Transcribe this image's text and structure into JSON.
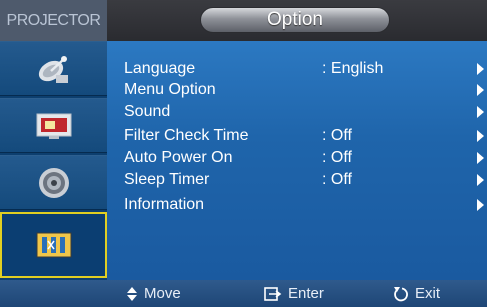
{
  "header": {
    "brand": "PROJECTOR",
    "title": "Option"
  },
  "sidebar": {
    "items": [
      {
        "icon": "satellite-dish-icon",
        "name": "input-category"
      },
      {
        "icon": "picture-icon",
        "name": "picture-category"
      },
      {
        "icon": "speaker-icon",
        "name": "setup-category"
      },
      {
        "icon": "option-icon",
        "name": "option-category",
        "active": true
      }
    ]
  },
  "menu": {
    "items": [
      {
        "label": "Language",
        "value": ": English",
        "has_arrow": true
      },
      {
        "label": "Menu Option",
        "value": "",
        "has_arrow": true
      },
      {
        "label": "Sound",
        "value": "",
        "has_arrow": true
      },
      {
        "label": "Filter Check Time",
        "value": ": Off",
        "has_arrow": true
      },
      {
        "label": "Auto Power On",
        "value": ": Off",
        "has_arrow": true
      },
      {
        "label": "Sleep Timer",
        "value": ": Off",
        "has_arrow": true
      },
      {
        "label": "Information",
        "value": "",
        "has_arrow": true
      }
    ]
  },
  "footer": {
    "move": "Move",
    "enter": "Enter",
    "exit": "Exit"
  },
  "colors": {
    "panel": "#1f65ab",
    "sidebar": "#0d3f6f",
    "active_border": "#e1cf22",
    "topbar": "#2a2b30"
  }
}
